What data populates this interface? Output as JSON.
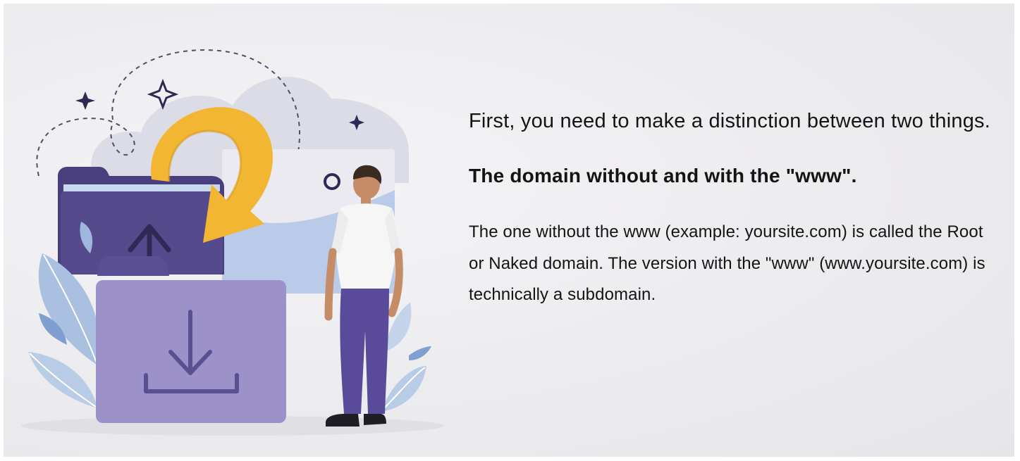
{
  "illustration": {
    "alt_icons": [
      "sparkle-icon",
      "curved-arrow-icon",
      "upload-arrow-icon",
      "download-icon",
      "folder-icon"
    ],
    "colors": {
      "folder_dark": "#4a3f7e",
      "folder_light": "#9d91c9",
      "arrow": "#f2b632",
      "leaf": "#a9c0e0",
      "cloud": "#dcdce6"
    }
  },
  "text": {
    "intro": "First, you need to make a distinction between two things.",
    "heading": "The domain without and with the \"www\".",
    "body": "The one without the www (example: yoursite.com) is called the Root or Naked domain. The version with the \"www\" (www.yoursite.com) is technically a subdomain."
  }
}
